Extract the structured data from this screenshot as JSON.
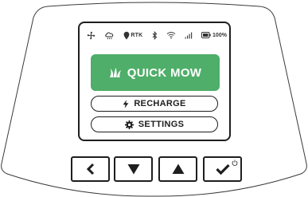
{
  "status_bar": {
    "icons": [
      "fan-icon",
      "cloud-rain-icon",
      "location-pin-icon",
      "bluetooth-icon",
      "wifi-icon",
      "signal-bars-icon",
      "battery-icon"
    ],
    "rtk_label": "RTK",
    "battery_percent": "100%"
  },
  "menu": {
    "quick_mow_label": "QUICK MOW",
    "recharge_label": "RECHARGE",
    "settings_label": "SETTINGS"
  },
  "keypad": {
    "keys": [
      "back-chevron-icon",
      "down-triangle-icon",
      "up-triangle-icon",
      "checkmark-icon",
      "power-icon"
    ]
  },
  "colors": {
    "accent_green": "#4fae69",
    "outline": "#1e1e1e"
  }
}
